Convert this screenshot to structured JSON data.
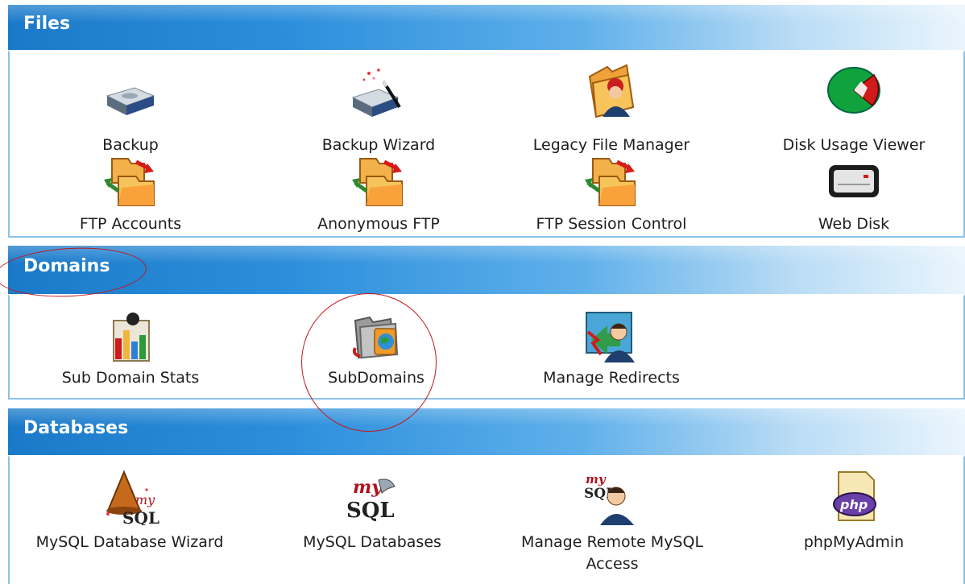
{
  "sections": [
    {
      "title": "Files",
      "items": [
        {
          "label": "Backup",
          "icon": "backup-icon"
        },
        {
          "label": "Backup Wizard",
          "icon": "backup-wizard-icon"
        },
        {
          "label": "Legacy File Manager",
          "icon": "file-manager-icon"
        },
        {
          "label": "Disk Usage Viewer",
          "icon": "disk-usage-icon"
        },
        {
          "label": "FTP Accounts",
          "icon": "ftp-folder-icon"
        },
        {
          "label": "Anonymous FTP",
          "icon": "ftp-folder-icon"
        },
        {
          "label": "FTP Session Control",
          "icon": "ftp-folder-icon"
        },
        {
          "label": "Web Disk",
          "icon": "web-disk-icon"
        }
      ]
    },
    {
      "title": "Domains",
      "items": [
        {
          "label": "Sub Domain Stats",
          "icon": "stats-chart-icon"
        },
        {
          "label": "SubDomains",
          "icon": "subdomains-folder-globe-icon"
        },
        {
          "label": "Manage Redirects",
          "icon": "redirect-user-icon"
        }
      ]
    },
    {
      "title": "Databases",
      "items": [
        {
          "label": "MySQL Database Wizard",
          "icon": "mysql-wizard-icon"
        },
        {
          "label": "MySQL Databases",
          "icon": "mysql-icon"
        },
        {
          "label": "Manage Remote MySQL Access",
          "icon": "mysql-remote-user-icon"
        },
        {
          "label": "phpMyAdmin",
          "icon": "phpmyadmin-icon"
        }
      ]
    }
  ],
  "icon_text": {
    "my": "my",
    "sql": "SQL",
    "php": "php"
  },
  "colors": {
    "header_start": "#1a7ac9",
    "header_end": "#eaf5fd",
    "panel_border": "#8cc2ea",
    "highlight_circle": "#c0161b"
  }
}
